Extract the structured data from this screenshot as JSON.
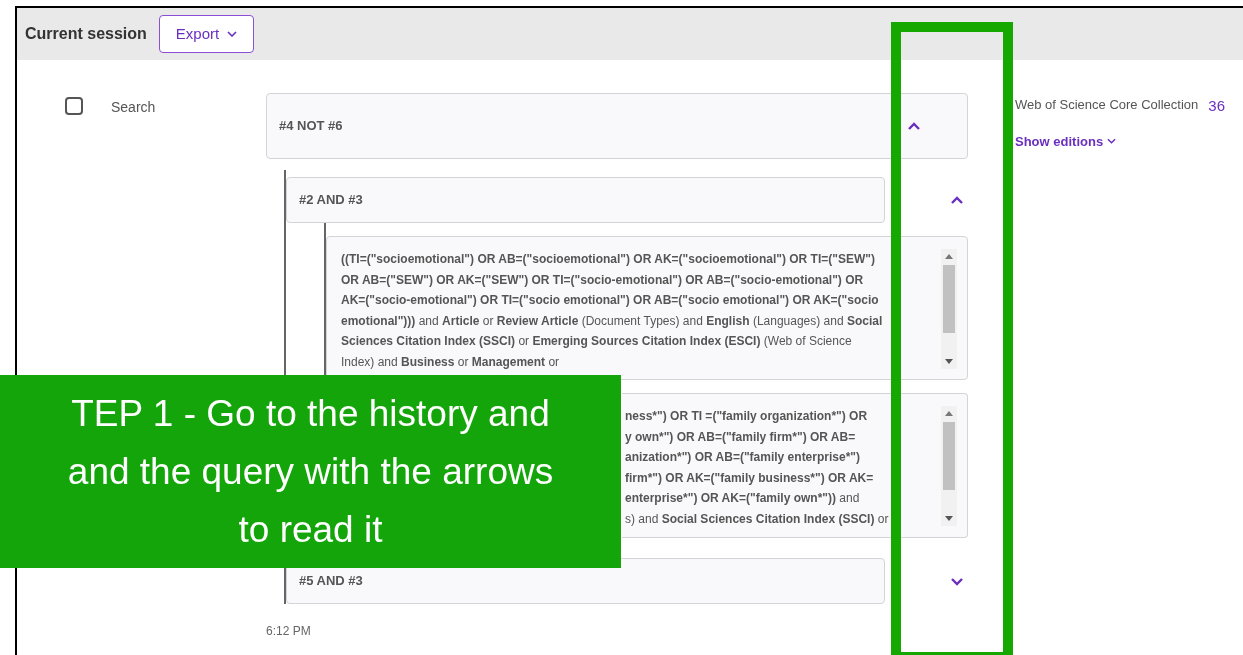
{
  "header": {
    "title": "Current session",
    "export_button": "Export"
  },
  "history_item": {
    "checked": false,
    "label": "Search",
    "collection": "Web of Science Core Collection",
    "count": "36",
    "editions_link": "Show editions",
    "time": "6:12 PM",
    "query": {
      "text": "#4 NOT #6",
      "expanded": true,
      "children": [
        {
          "text": "#2 AND #3",
          "expanded": true,
          "children": [
            {
              "kind": "full",
              "text": "**((TI=(\"socioemotional\") OR AB=(\"socioemotional\") OR AK=(\"socioemotional\") OR TI=(\"SEW\") OR AB=(\"SEW\") OR AK=(\"SEW\") OR TI=(\"socio-emotional\") OR AB=(\"socio-emotional\") OR AK=(\"socio-emotional\") OR TI=(\"socio emotional\") OR AB=(\"socio emotional\") OR AK=(\"socio emotional\")))** and **Article** or **Review Article** (Document Types) and **English** (Languages) and **Social Sciences Citation Index (SSCI)** or **Emerging Sources Citation Index (ESCI)** (Web of Science Index) and **Business** or **Management** or"
            },
            {
              "kind": "partial",
              "lines": [
                "**ness*\") OR TI =(\"family organization*\") OR**",
                "**y own*\") OR AB=(\"family firm*\") OR AB=**",
                "**anization*\") OR AB=(\"family enterprise*\")**",
                "**firm*\") OR AK=(\"family business*\") OR AK=**",
                "**enterprise*\") OR AK=(\"family own*\"))** and",
                "s) and **Social Sciences Citation Index (SSCI)** or"
              ]
            }
          ]
        },
        {
          "text": "#5 AND #3",
          "expanded": false
        }
      ]
    }
  },
  "annotation": {
    "lines": [
      "TEP 1 - Go to the history and",
      "and the query with the arrows",
      "to read it"
    ]
  }
}
